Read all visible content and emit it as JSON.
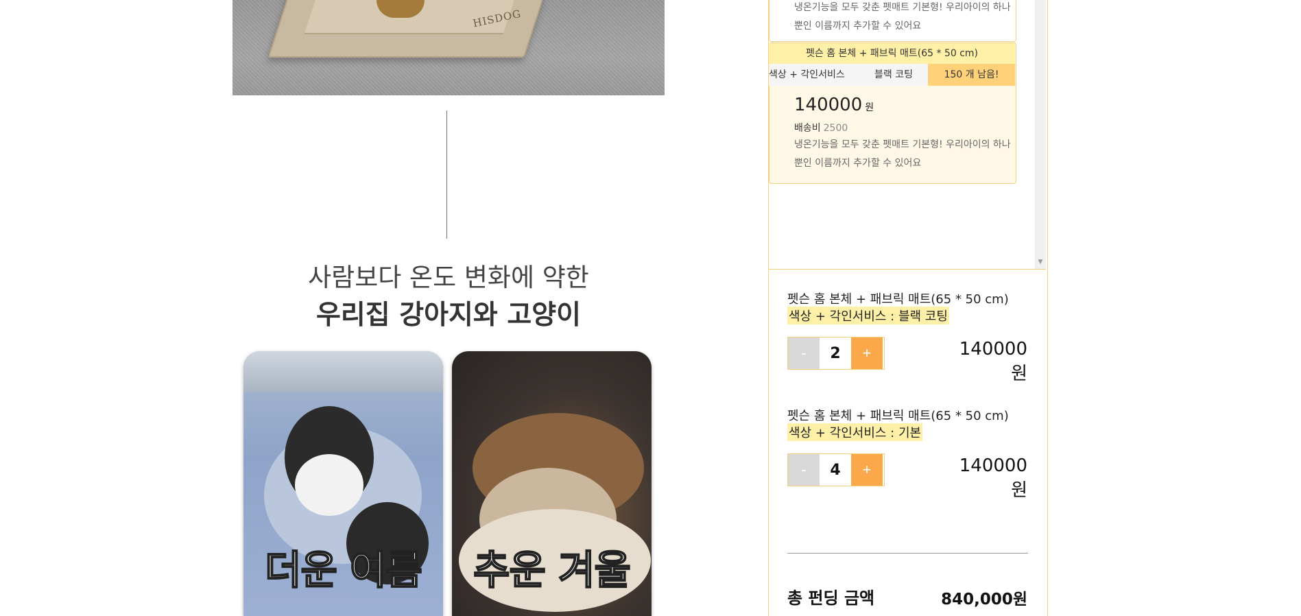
{
  "top_photo": {
    "brand_text": "HISDOG"
  },
  "headline": {
    "line1": "사람보다 온도 변화에 약한",
    "line2": "우리집 강아지와 고양이"
  },
  "cards": [
    {
      "label": "더운 여름"
    },
    {
      "label": "추운 겨울"
    }
  ],
  "option_panel": {
    "prev_option": {
      "description": "냉온기능을 모두 갖춘 펫매트 기본형! 우리아이의 하나뿐인 이름까지 추가할 수 있어요"
    },
    "option": {
      "title": "펫슨 홈 본체 + 패브릭 매트(65 * 50 cm)",
      "tab_name": "색상 + 각인서비스",
      "tab_value": "블랙 코팅",
      "stock": "150 개 남음!",
      "price": "140000",
      "price_unit": "원",
      "shipping_label": "배송비",
      "shipping_value": "2500",
      "description": "냉온기능을 모두 갖춘 펫매트 기본형! 우리아이의 하나뿐인 이름까지 추가할 수 있어요"
    }
  },
  "selected_items": [
    {
      "title": "펫슨 홈 본체 + 패브릭 매트(65 * 50 cm)",
      "option": "색상 + 각인서비스 : 블랙 코팅",
      "minus": "-",
      "quantity": "2",
      "plus": "+",
      "price": "140000 원"
    },
    {
      "title": "펫슨 홈 본체 + 패브릭 매트(65 * 50 cm)",
      "option": "색상 + 각인서비스 : 기본",
      "minus": "-",
      "quantity": "4",
      "plus": "+",
      "price": "140000 원"
    }
  ],
  "total": {
    "label": "총 펀딩 금액",
    "value": "840,000원"
  },
  "colors": {
    "accent_orange": "#fba84a",
    "highlight_yellow": "#fff0a8",
    "panel_border": "#f4cf7e"
  }
}
